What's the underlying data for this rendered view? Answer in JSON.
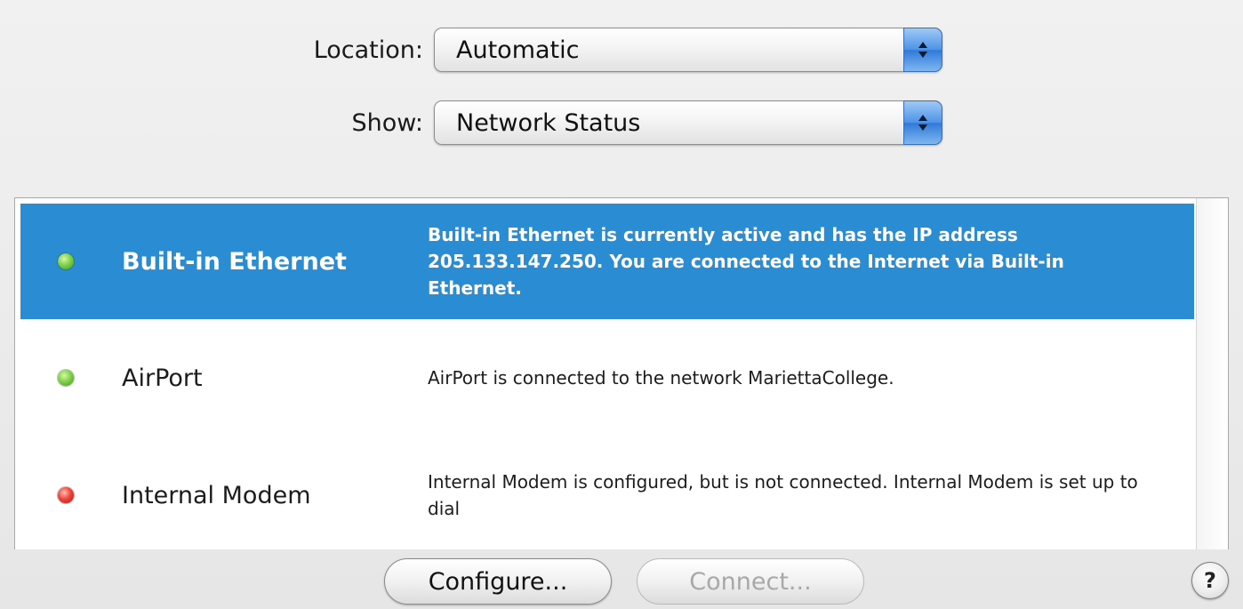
{
  "location": {
    "label": "Location:",
    "value": "Automatic"
  },
  "show": {
    "label": "Show:",
    "value": "Network Status"
  },
  "services": [
    {
      "name": "Built-in Ethernet",
      "status": "green",
      "selected": true,
      "description": "Built-in Ethernet is currently active and has the IP address 205.133.147.250. You are connected to the Internet via Built-in Ethernet."
    },
    {
      "name": "AirPort",
      "status": "green",
      "selected": false,
      "description": "AirPort is connected to the network MariettaCollege."
    },
    {
      "name": "Internal Modem",
      "status": "red",
      "selected": false,
      "description": "Internal Modem is configured, but is not connected. Internal Modem is set up to dial"
    }
  ],
  "buttons": {
    "configure": "Configure...",
    "connect": "Connect...",
    "help": "?"
  },
  "colors": {
    "selection": "#2a8cd2",
    "status_green": "#5cc02e",
    "status_red": "#e02a22"
  },
  "icons": {
    "popup_arrows": "up-down-arrows-icon",
    "status_dot": "status-indicator-icon",
    "help": "help-icon"
  }
}
